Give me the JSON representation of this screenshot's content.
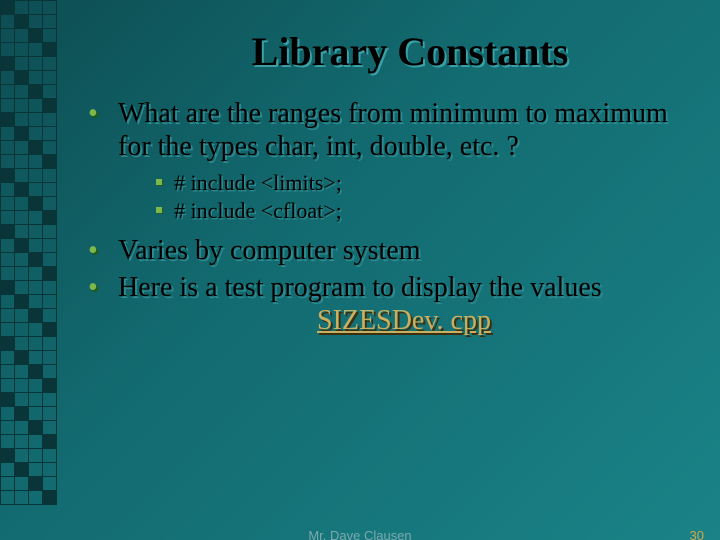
{
  "title": "Library Constants",
  "bullets": {
    "b1": "What are the ranges from minimum to maximum for the types char, int, double, etc. ?",
    "sub1": "# include <limits>;",
    "sub2": "# include <cfloat>;",
    "b2": "Varies by computer system",
    "b3": "Here is a test program to display the values",
    "link": "SIZESDev. cpp"
  },
  "footer": {
    "author": "Mr. Dave Clausen",
    "page": "30"
  }
}
